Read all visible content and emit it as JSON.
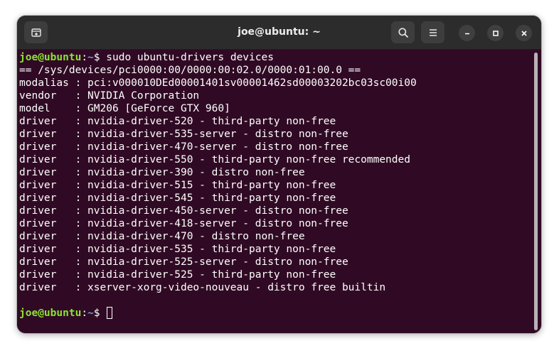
{
  "window": {
    "title": "joe@ubuntu: ~"
  },
  "icons": {
    "new_tab": "new-tab-icon",
    "search": "search-icon",
    "menu": "hamburger-menu-icon",
    "minimize": "minimize-icon",
    "maximize": "maximize-icon",
    "close": "close-icon"
  },
  "colors": {
    "terminal_bg": "#300a24",
    "prompt_user": "#8ae234",
    "prompt_path": "#729fcf",
    "text": "#ffffff"
  },
  "terminal": {
    "prompt": {
      "user": "joe@ubuntu",
      "separator": ":",
      "path": "~",
      "symbol": "$ "
    },
    "command": "sudo ubuntu-drivers devices",
    "output": [
      "== /sys/devices/pci0000:00/0000:00:02.0/0000:01:00.0 ==",
      "modalias : pci:v000010DEd00001401sv00001462sd00003202bc03sc00i00",
      "vendor   : NVIDIA Corporation",
      "model    : GM206 [GeForce GTX 960]",
      "driver   : nvidia-driver-520 - third-party non-free",
      "driver   : nvidia-driver-535-server - distro non-free",
      "driver   : nvidia-driver-470-server - distro non-free",
      "driver   : nvidia-driver-550 - third-party non-free recommended",
      "driver   : nvidia-driver-390 - distro non-free",
      "driver   : nvidia-driver-515 - third-party non-free",
      "driver   : nvidia-driver-545 - third-party non-free",
      "driver   : nvidia-driver-450-server - distro non-free",
      "driver   : nvidia-driver-418-server - distro non-free",
      "driver   : nvidia-driver-470 - distro non-free",
      "driver   : nvidia-driver-535 - third-party non-free",
      "driver   : nvidia-driver-525-server - distro non-free",
      "driver   : nvidia-driver-525 - third-party non-free",
      "driver   : xserver-xorg-video-nouveau - distro free builtin",
      ""
    ]
  }
}
